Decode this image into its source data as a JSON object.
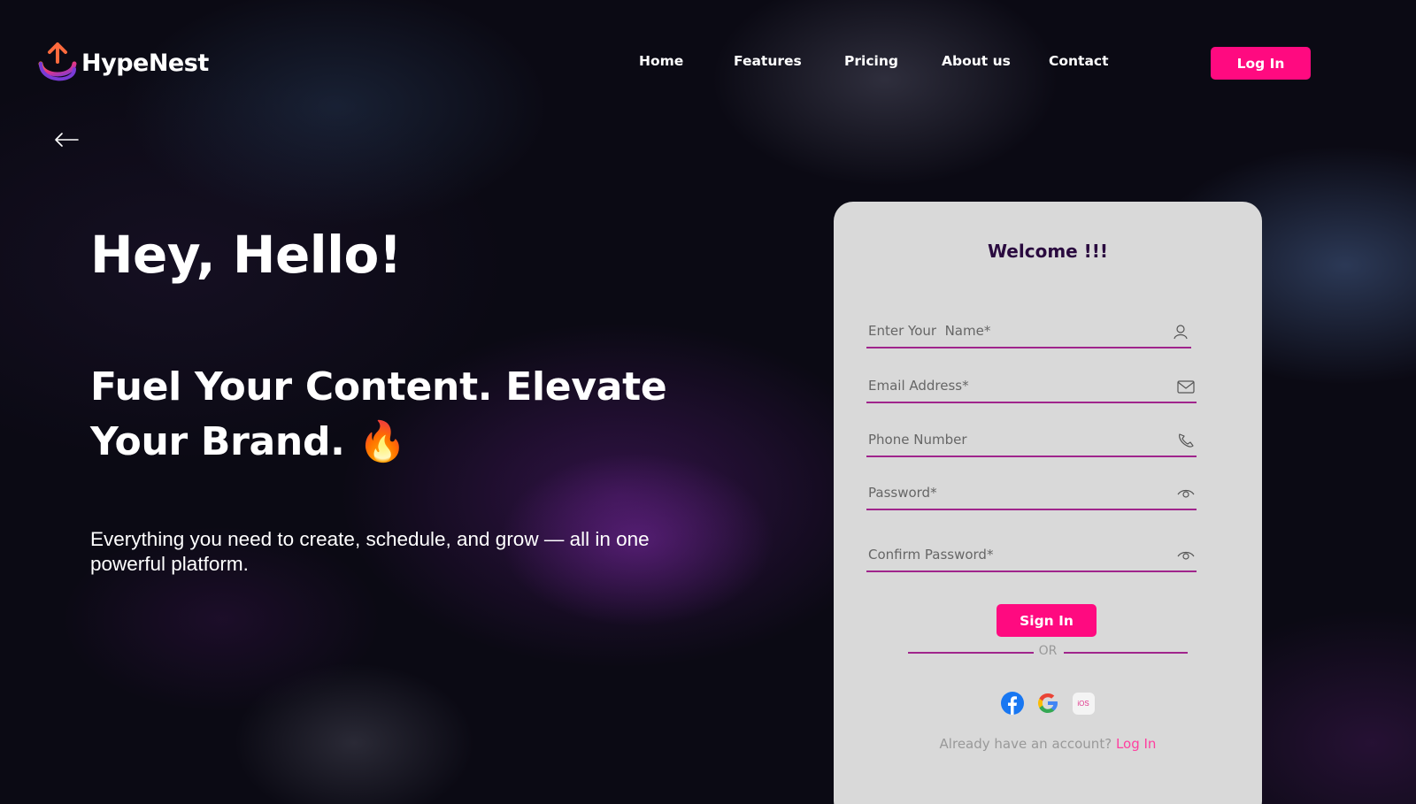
{
  "brand": {
    "name": "HypeNest",
    "accent": "#ff0a80"
  },
  "nav": {
    "items": [
      {
        "label": "Home"
      },
      {
        "label": "Features"
      },
      {
        "label": "Pricing"
      },
      {
        "label": "About us"
      },
      {
        "label": "Contact"
      }
    ],
    "login_label": "Log In"
  },
  "hero": {
    "title": "Hey, Hello!",
    "subtitle": "Fuel Your Content. Elevate Your Brand. 🔥",
    "description": "Everything you need to create, schedule, and grow — all in one powerful platform."
  },
  "form": {
    "title": "Welcome !!!",
    "name_placeholder": "Enter Your  Name*",
    "email_placeholder": "Email Address*",
    "phone_placeholder": "Phone Number",
    "password_placeholder": "Password*",
    "confirm_placeholder": "Confirm Password*",
    "submit_label": "Sign In",
    "divider_text": "OR",
    "ios_label": "iOS",
    "already_text": "Already have an account?",
    "login_link": "Log In"
  },
  "icons": {
    "back": "arrow-left-icon",
    "name": "user-icon",
    "email": "mail-icon",
    "phone": "phone-icon",
    "password": "eye-icon"
  }
}
